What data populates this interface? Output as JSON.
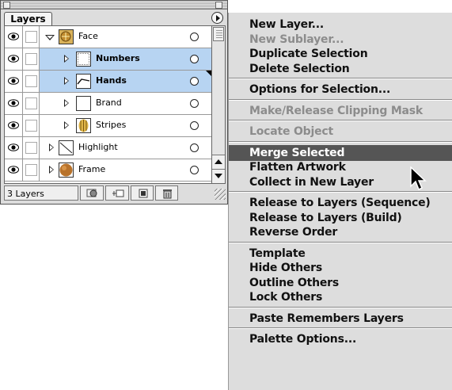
{
  "palette": {
    "tab_label": "Layers",
    "layer_count": "3 Layers",
    "rows": [
      {
        "name": "Face",
        "level": 0,
        "expanded": true,
        "selected": false,
        "bold": false,
        "thumb": "face-thumb"
      },
      {
        "name": "Numbers",
        "level": 1,
        "expanded": false,
        "selected": true,
        "bold": true,
        "thumb": "numbers-thumb"
      },
      {
        "name": "Hands",
        "level": 1,
        "expanded": false,
        "selected": true,
        "bold": true,
        "thumb": "hands-thumb"
      },
      {
        "name": "Brand",
        "level": 1,
        "expanded": false,
        "selected": false,
        "bold": false,
        "thumb": "brand-thumb"
      },
      {
        "name": "Stripes",
        "level": 1,
        "expanded": false,
        "selected": false,
        "bold": false,
        "thumb": "stripes-thumb"
      },
      {
        "name": "Highlight",
        "level": 0,
        "expanded": false,
        "selected": false,
        "bold": false,
        "thumb": "highlight-thumb"
      },
      {
        "name": "Frame",
        "level": 0,
        "expanded": false,
        "selected": false,
        "bold": false,
        "thumb": "frame-thumb"
      }
    ],
    "bottom_buttons": [
      "make-clipping-mask-icon",
      "new-sublayer-icon",
      "new-layer-icon",
      "trash-icon"
    ]
  },
  "menu": {
    "groups": [
      [
        {
          "label": "New Layer...",
          "disabled": false
        },
        {
          "label": "New Sublayer...",
          "disabled": true
        },
        {
          "label": "Duplicate Selection",
          "disabled": false
        },
        {
          "label": "Delete Selection",
          "disabled": false
        }
      ],
      [
        {
          "label": "Options for Selection...",
          "disabled": false
        }
      ],
      [
        {
          "label": "Make/Release Clipping Mask",
          "disabled": true
        }
      ],
      [
        {
          "label": "Locate Object",
          "disabled": true
        }
      ],
      [
        {
          "label": "Merge Selected",
          "disabled": false,
          "highlighted": true
        },
        {
          "label": "Flatten Artwork",
          "disabled": false
        },
        {
          "label": "Collect in New Layer",
          "disabled": false
        }
      ],
      [
        {
          "label": "Release to Layers (Sequence)",
          "disabled": false
        },
        {
          "label": "Release to Layers (Build)",
          "disabled": false
        },
        {
          "label": "Reverse Order",
          "disabled": false
        }
      ],
      [
        {
          "label": "Template",
          "disabled": false
        },
        {
          "label": "Hide Others",
          "disabled": false
        },
        {
          "label": "Outline Others",
          "disabled": false
        },
        {
          "label": "Lock Others",
          "disabled": false
        }
      ],
      [
        {
          "label": "Paste Remembers Layers",
          "disabled": false
        }
      ],
      [
        {
          "label": "Palette Options...",
          "disabled": false
        }
      ]
    ]
  }
}
